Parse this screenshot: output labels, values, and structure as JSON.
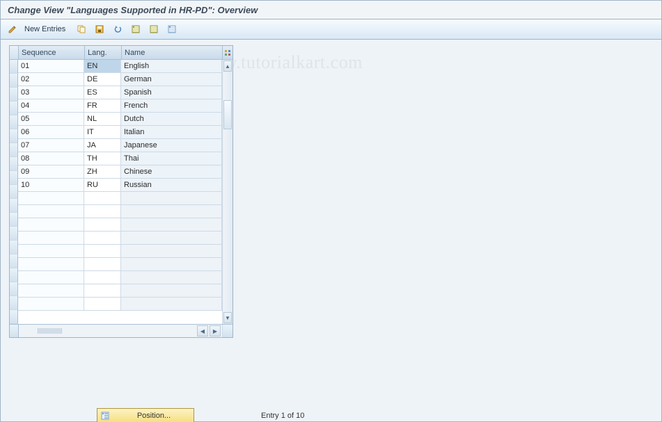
{
  "title": "Change View \"Languages Supported in HR-PD\": Overview",
  "watermark": "www.tutorialkart.com",
  "toolbar": {
    "new_entries_label": "New Entries"
  },
  "table": {
    "headers": {
      "sequence": "Sequence",
      "lang": "Lang.",
      "name": "Name"
    },
    "rows": [
      {
        "sequence": "01",
        "lang": "EN",
        "name": "English"
      },
      {
        "sequence": "02",
        "lang": "DE",
        "name": "German"
      },
      {
        "sequence": "03",
        "lang": "ES",
        "name": "Spanish"
      },
      {
        "sequence": "04",
        "lang": "FR",
        "name": "French"
      },
      {
        "sequence": "05",
        "lang": "NL",
        "name": "Dutch"
      },
      {
        "sequence": "06",
        "lang": "IT",
        "name": "Italian"
      },
      {
        "sequence": "07",
        "lang": "JA",
        "name": "Japanese"
      },
      {
        "sequence": "08",
        "lang": "TH",
        "name": "Thai"
      },
      {
        "sequence": "09",
        "lang": "ZH",
        "name": "Chinese"
      },
      {
        "sequence": "10",
        "lang": "RU",
        "name": "Russian"
      }
    ],
    "empty_rows": 9
  },
  "footer": {
    "position_label": "Position...",
    "entry_text": "Entry 1 of 10"
  },
  "colors": {
    "accent": "#d8e8f5",
    "header_bg": "#c9dbeb",
    "body_bg": "#eef3f8"
  }
}
